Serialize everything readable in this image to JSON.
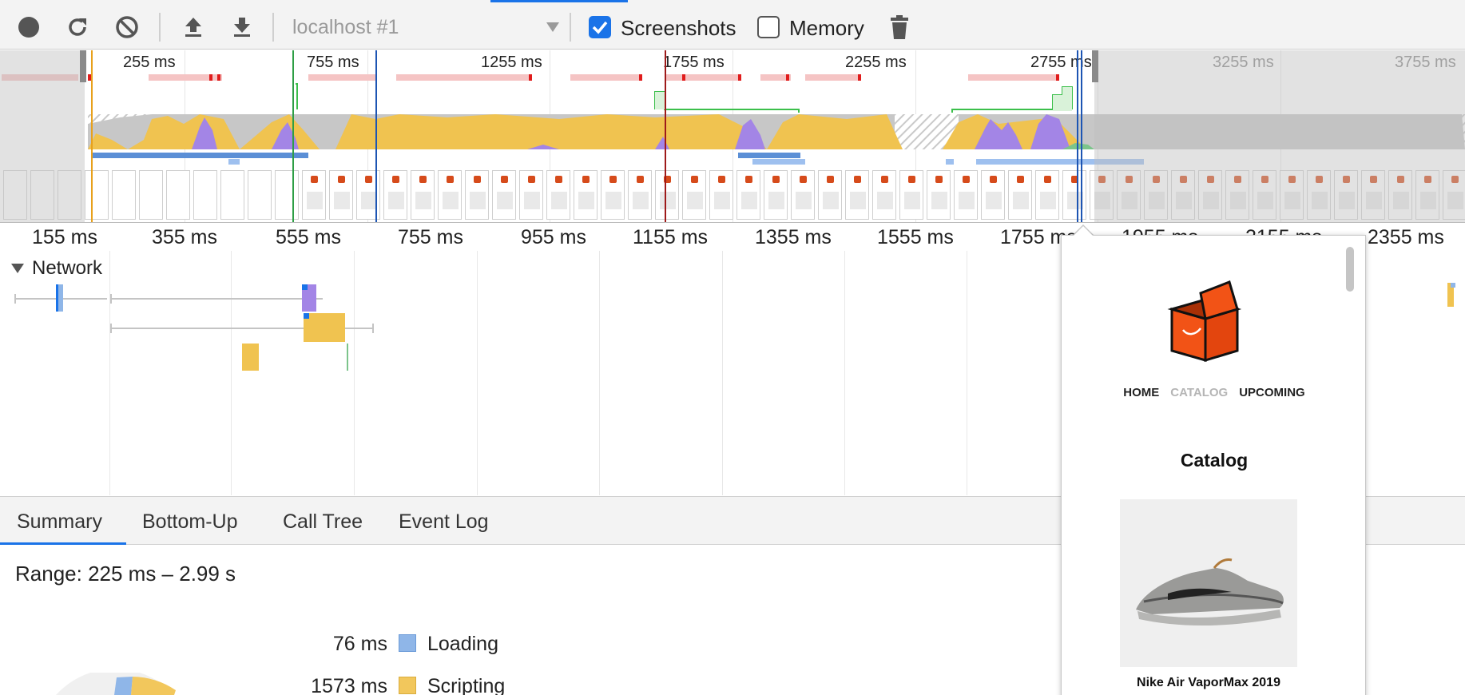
{
  "toolbar": {
    "record_icon": "record-icon",
    "reload_icon": "reload-icon",
    "clear_icon": "clear-icon",
    "upload_icon": "upload-icon",
    "download_icon": "download-icon",
    "profile_select": "localhost #1",
    "screenshots_label": "Screenshots",
    "screenshots_checked": true,
    "memory_label": "Memory",
    "memory_checked": false,
    "gc_icon": "trash-icon"
  },
  "overview": {
    "time_labels": [
      "255 ms",
      "755 ms",
      "1255 ms",
      "1755 ms",
      "2255 ms",
      "2755 ms",
      "3255 ms",
      "3755 ms"
    ]
  },
  "ruler": {
    "labels": [
      "155 ms",
      "355 ms",
      "555 ms",
      "755 ms",
      "955 ms",
      "1155 ms",
      "1355 ms",
      "1555 ms",
      "1755 ms",
      "1955 ms",
      "2155 ms",
      "2355 ms"
    ]
  },
  "network": {
    "title": "Network"
  },
  "tabs": {
    "items": [
      "Summary",
      "Bottom-Up",
      "Call Tree",
      "Event Log"
    ],
    "active": "Summary"
  },
  "summary": {
    "range": "Range: 225 ms – 2.99 s",
    "legend": [
      {
        "value": "76 ms",
        "name": "Loading",
        "color": "#8fb6e8"
      },
      {
        "value": "1573 ms",
        "name": "Scripting",
        "color": "#f2c75c"
      }
    ]
  },
  "popover": {
    "nav": [
      "HOME",
      "CATALOG",
      "UPCOMING"
    ],
    "title": "Catalog",
    "product_name": "Nike Air VaporMax 2019"
  },
  "colors": {
    "accent": "#1a73e8",
    "scripting": "#f0c350",
    "rendering": "#a385e6",
    "loading": "#8fb6e8",
    "network_red": "#f5c4c4"
  }
}
